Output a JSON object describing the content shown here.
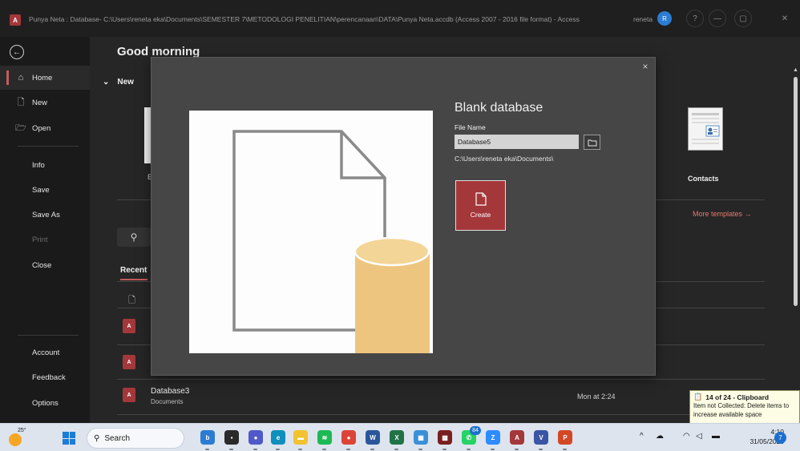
{
  "window": {
    "app_icon": "A",
    "title": "Punya Neta : Database- C:\\Users\\reneta eka\\Documents\\SEMESTER 7\\METODOLOGI PENELITIAN\\perencanaan\\DATA\\Punya Neta.accdb (Access 2007 - 2016 file format) - Access",
    "user_name": "reneta",
    "user_initial": "R",
    "help": "?",
    "minimize": "—",
    "restore": "▢",
    "close": "✕"
  },
  "sidebar": {
    "back_icon": "←",
    "items": [
      {
        "label": "Home",
        "icon": "⌂"
      },
      {
        "label": "New",
        "icon": "🗋"
      },
      {
        "label": "Open",
        "icon": "🗁"
      },
      {
        "label": "Info"
      },
      {
        "label": "Save"
      },
      {
        "label": "Save As"
      },
      {
        "label": "Print"
      },
      {
        "label": "Close"
      },
      {
        "label": "Account"
      },
      {
        "label": "Feedback"
      },
      {
        "label": "Options"
      }
    ]
  },
  "main": {
    "greeting": "Good morning",
    "new_heading": "New",
    "new_chevron": "⌄",
    "blank_template_fragment": "B",
    "contacts_label": "Contacts",
    "more_templates": "More templates →",
    "search_icon": "⚲",
    "recent_tab": "Recent",
    "recent_file": {
      "name": "Database3",
      "location": "Documents",
      "date": "Mon at 2:24",
      "icon": "A"
    },
    "partial_file_icon": "A"
  },
  "dialog": {
    "title": "Blank database",
    "file_name_label": "File Name",
    "file_name_value": "Database5",
    "save_path": "C:\\Users\\reneta eka\\Documents\\",
    "create_label": "Create",
    "close": "×"
  },
  "clipboard_toast": {
    "title": "14 of 24 - Clipboard",
    "message": "Item not Collected: Delete items to increase available space"
  },
  "taskbar": {
    "weather_temp": "25°",
    "search_label": "Search",
    "apps": [
      {
        "name": "bing-chat",
        "label": "b",
        "color": "#2b7cd3"
      },
      {
        "name": "task-view",
        "label": "▪",
        "color": "#2a2a2a"
      },
      {
        "name": "chat",
        "label": "●",
        "color": "#5059c9"
      },
      {
        "name": "edge",
        "label": "e",
        "color": "#0f8fbd"
      },
      {
        "name": "file-explorer",
        "label": "▬",
        "color": "#f2c230"
      },
      {
        "name": "spotify",
        "label": "≋",
        "color": "#1db954"
      },
      {
        "name": "chrome",
        "label": "●",
        "color": "#db4437"
      },
      {
        "name": "word",
        "label": "W",
        "color": "#2b579a"
      },
      {
        "name": "excel",
        "label": "X",
        "color": "#217346"
      },
      {
        "name": "store",
        "label": "▦",
        "color": "#3a8fd8"
      },
      {
        "name": "app-red",
        "label": "▩",
        "color": "#7a1f1f"
      },
      {
        "name": "whatsapp",
        "label": "✆",
        "color": "#25d366"
      },
      {
        "name": "zoom",
        "label": "Z",
        "color": "#2d8cff"
      },
      {
        "name": "access",
        "label": "A",
        "color": "#a4373a"
      },
      {
        "name": "visio",
        "label": "V",
        "color": "#3955a3"
      },
      {
        "name": "powerpoint",
        "label": "P",
        "color": "#d24726"
      }
    ],
    "whatsapp_badge": "84",
    "tray_chevron": "^",
    "time": "4:10",
    "date": "31/05/2023",
    "notification_count": "7"
  }
}
